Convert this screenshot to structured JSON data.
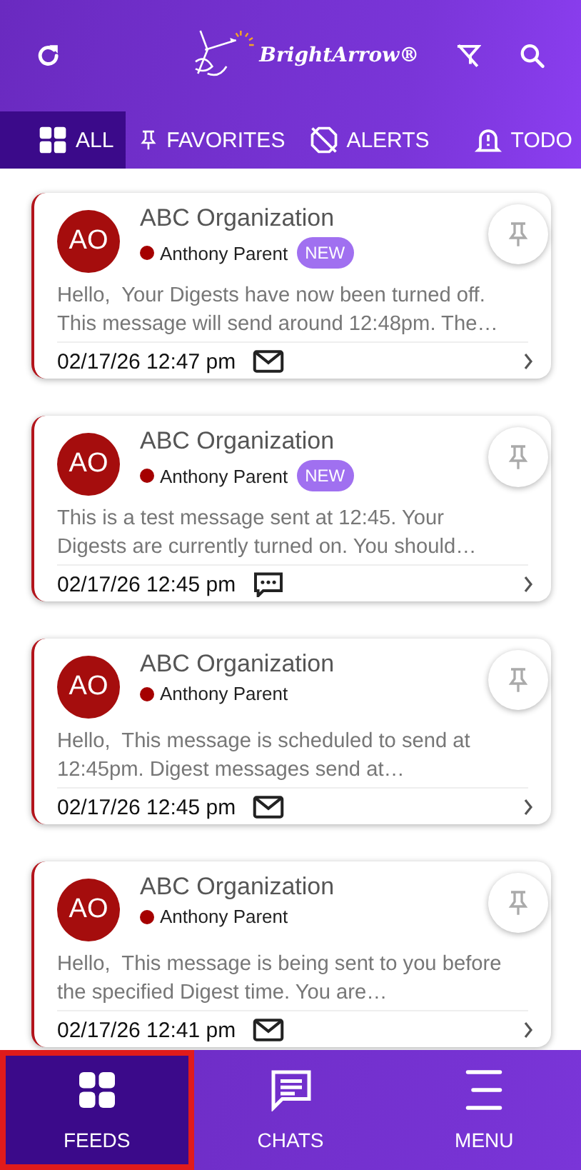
{
  "header": {
    "logo": "BrightArrow®"
  },
  "tabs": [
    {
      "label": "ALL",
      "selected": true
    },
    {
      "label": "FAVORITES",
      "selected": false
    },
    {
      "label": "ALERTS",
      "selected": false
    },
    {
      "label": "TODO",
      "selected": false
    }
  ],
  "messages": [
    {
      "initials": "AO",
      "organization": "ABC Organization",
      "recipient": "Anthony Parent",
      "badge": "NEW",
      "text": "Hello,  Your Digests have now been turned off. This message will send around 12:48pm. The…",
      "date": "02/17/26 12:47 pm",
      "kind": "email"
    },
    {
      "initials": "AO",
      "organization": "ABC Organization",
      "recipient": "Anthony Parent",
      "badge": "NEW",
      "text": "This is a test message sent at 12:45. Your Digests are currently turned on. You should…",
      "date": "02/17/26 12:45 pm",
      "kind": "chat"
    },
    {
      "initials": "AO",
      "organization": "ABC Organization",
      "recipient": "Anthony Parent",
      "text": "Hello,  This message is scheduled to send at 12:45pm. Digest messages send at…",
      "date": "02/17/26 12:45 pm",
      "kind": "email"
    },
    {
      "initials": "AO",
      "organization": "ABC Organization",
      "recipient": "Anthony Parent",
      "text": "Hello,  This message is being sent to you before the specified Digest time. You are…",
      "date": "02/17/26 12:41 pm",
      "kind": "email"
    }
  ],
  "nav": [
    {
      "label": "FEEDS",
      "selected": true,
      "highlighted": true
    },
    {
      "label": "CHATS",
      "selected": false,
      "highlighted": false
    },
    {
      "label": "MENU",
      "selected": false,
      "highlighted": false
    }
  ]
}
